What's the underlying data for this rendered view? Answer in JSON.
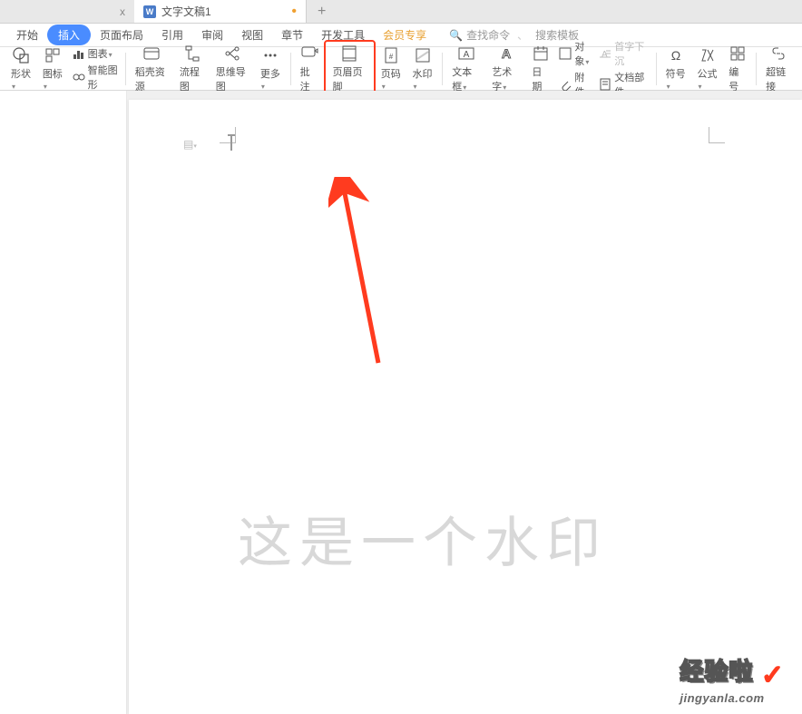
{
  "tabs": {
    "prev_suffix": "x",
    "active_label": "文字文稿1",
    "modified_marker": "•"
  },
  "menu": {
    "start": "开始",
    "insert": "插入",
    "page_layout": "页面布局",
    "reference": "引用",
    "review": "审阅",
    "view": "视图",
    "chapter": "章节",
    "dev_tools": "开发工具",
    "member": "会员专享"
  },
  "search": {
    "find_cmd": "查找命令",
    "search_template": "搜索模板"
  },
  "ribbon": {
    "shape": "形状",
    "icon": "图标",
    "chart": "图表",
    "smart_graphic": "智能图形",
    "dk_resource": "稻壳资源",
    "flowchart": "流程图",
    "mindmap": "思维导图",
    "more": "更多",
    "comment": "批注",
    "header_footer": "页眉页脚",
    "page_number": "页码",
    "watermark": "水印",
    "textbox": "文本框",
    "wordart": "艺术字",
    "date": "日期",
    "object": "对象",
    "attachment": "附件",
    "dropcap": "首字下沉",
    "doc_parts": "文档部件",
    "symbol": "符号",
    "formula": "公式",
    "number": "编号",
    "hyperlink": "超链接"
  },
  "document": {
    "watermark_text": "这是一个水印"
  },
  "branding": {
    "main": "经验啦",
    "sub": "jingyanla.com"
  }
}
